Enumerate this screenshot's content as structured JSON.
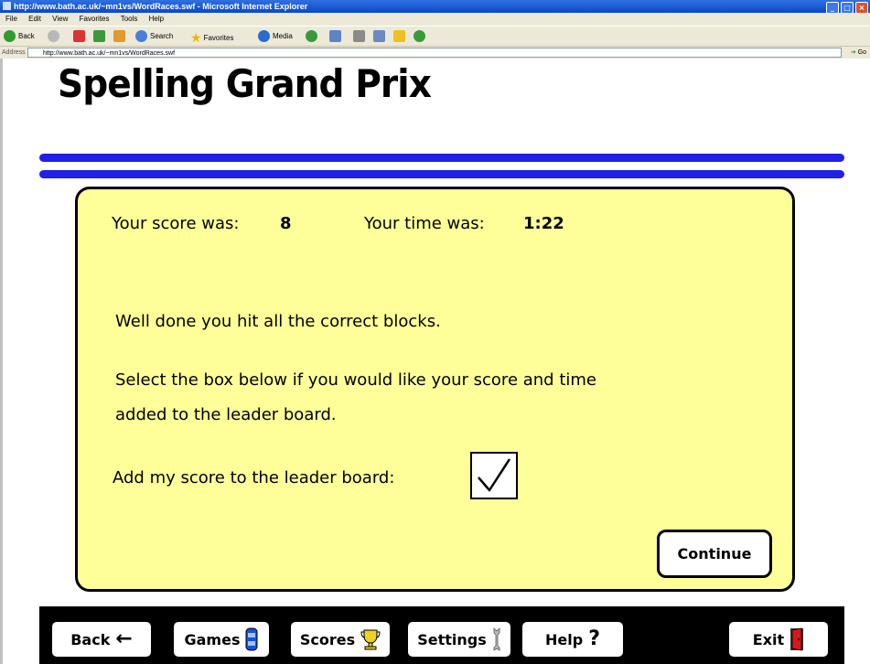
{
  "window": {
    "title": "http://www.bath.ac.uk/~mn1vs/WordRaces.swf - Microsoft Internet Explorer",
    "menu": [
      "File",
      "Edit",
      "View",
      "Favorites",
      "Tools",
      "Help"
    ],
    "toolbar": {
      "back": "Back",
      "search": "Search",
      "favorites": "Favorites",
      "media": "Media"
    },
    "address_label": "Address",
    "address": "http://www.bath.ac.uk/~mn1vs/WordRaces.swf",
    "go": "Go"
  },
  "game": {
    "title": "Spelling Grand Prix",
    "score_label": "Your score was:",
    "score": "8",
    "time_label": "Your time was:",
    "time": "1:22",
    "message": "Well done you hit all the correct blocks.",
    "instruction_line1": "Select the box below if you would like your score and time",
    "instruction_line2": "added to the leader board.",
    "checkbox_label": "Add my score to the leader board:",
    "checkbox_checked": true,
    "continue": "Continue"
  },
  "nav": {
    "back": "Back",
    "games": "Games",
    "scores": "Scores",
    "settings": "Settings",
    "help": "Help",
    "exit": "Exit"
  },
  "colors": {
    "panel": "#ffff99",
    "stripe": "#2020e8",
    "navbar": "#000000"
  }
}
